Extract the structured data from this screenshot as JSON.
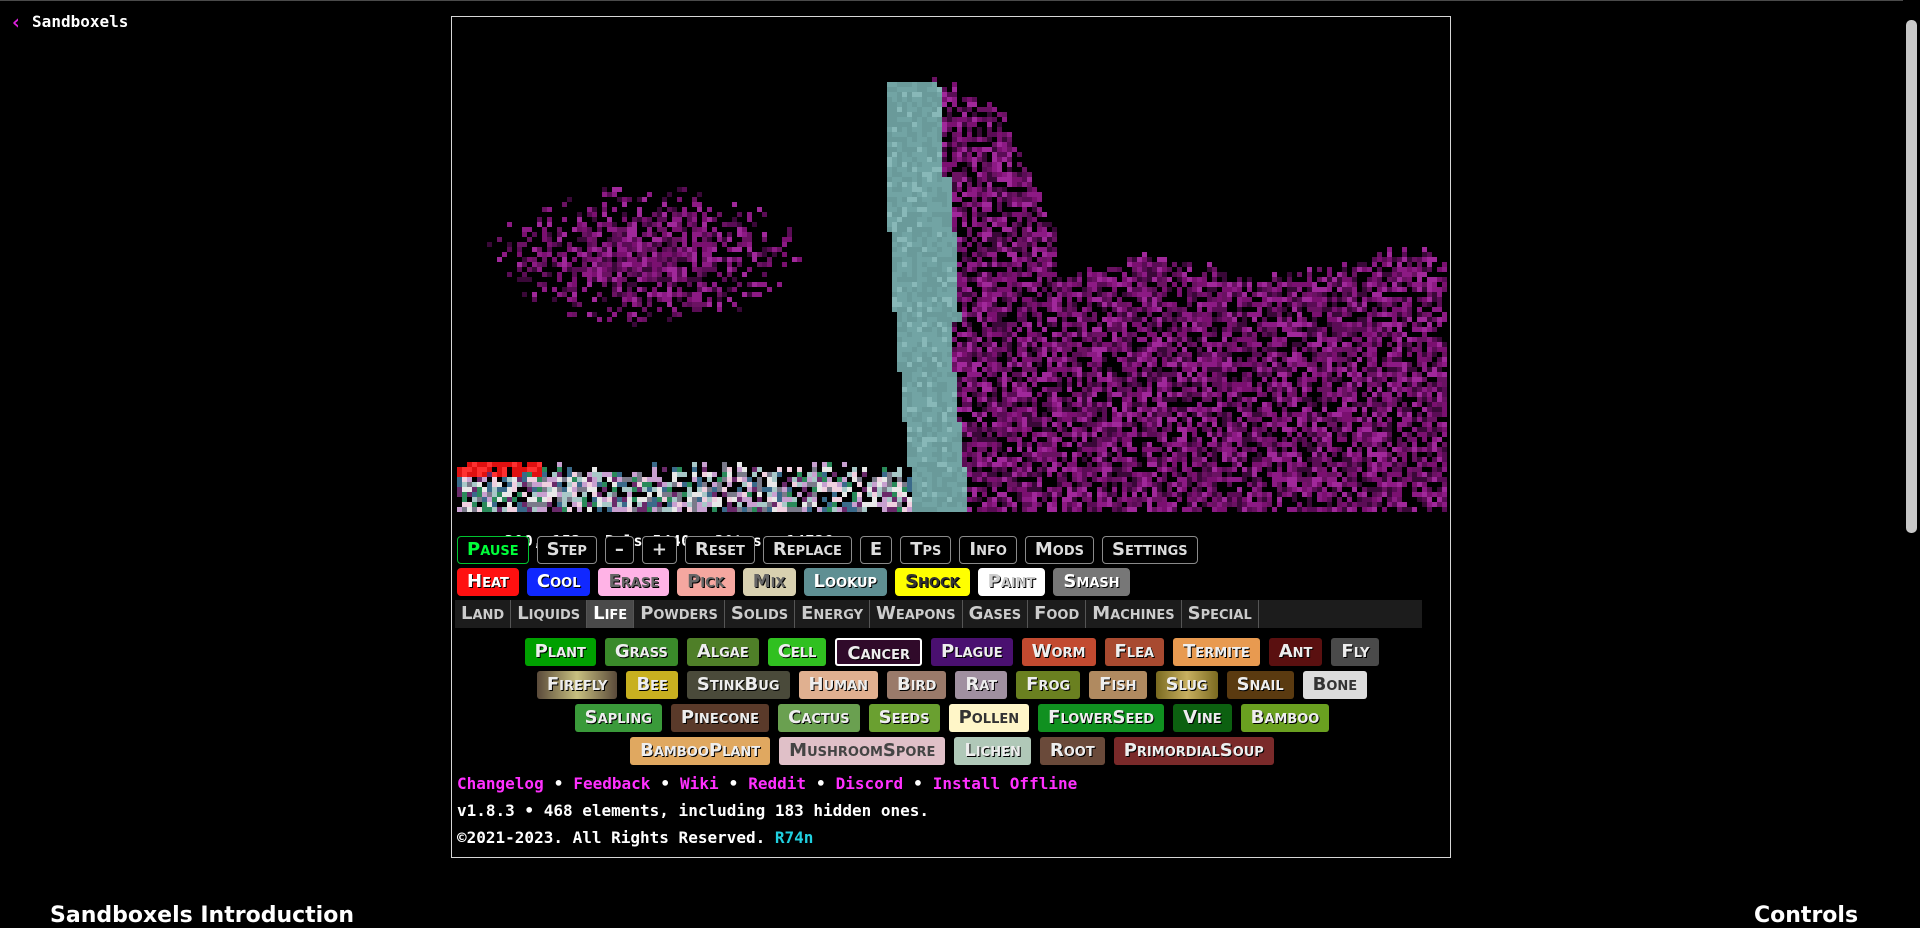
{
  "header": {
    "back_label": "Sandboxels"
  },
  "stats": {
    "coords": "x200,y153",
    "pixels": "Pxls:5440",
    "tps": "30tps",
    "ticks": "14738"
  },
  "controls": [
    {
      "label": "Pause",
      "fg": "#00ff3a",
      "border": "#00c430"
    },
    {
      "label": "Step"
    },
    {
      "label": "–"
    },
    {
      "label": "+"
    },
    {
      "label": "Reset"
    },
    {
      "label": "Replace"
    },
    {
      "label": "E"
    },
    {
      "label": "Tps"
    },
    {
      "label": "Info"
    },
    {
      "label": "Mods"
    },
    {
      "label": "Settings"
    }
  ],
  "tools": [
    {
      "label": "Heat",
      "bg": "#ff1010"
    },
    {
      "label": "Cool",
      "bg": "#1028ff"
    },
    {
      "label": "Erase",
      "bg": "#ffb3e6",
      "fg": "#666"
    },
    {
      "label": "Pick",
      "bg": "#f5a7a0",
      "fg": "#666"
    },
    {
      "label": "Mix",
      "bg": "#d8d0b0",
      "fg": "#666"
    },
    {
      "label": "Lookup",
      "bg": "#5f8f93"
    },
    {
      "label": "Shock",
      "bg": "#ffff00",
      "fg": "#333"
    },
    {
      "label": "Paint",
      "bg": "#ffffff",
      "fg": "#ccc"
    },
    {
      "label": "Smash",
      "bg": "#777777"
    }
  ],
  "categories": [
    "Land",
    "Liquids",
    "Life",
    "Powders",
    "Solids",
    "Energy",
    "Weapons",
    "Gases",
    "Food",
    "Machines",
    "Special"
  ],
  "active_category": "Life",
  "elements": [
    [
      {
        "label": "Plant",
        "bg": "#00a000"
      },
      {
        "label": "Grass",
        "bg": "#3a8a2a"
      },
      {
        "label": "Algae",
        "bg": "#4f7f28"
      },
      {
        "label": "Cell",
        "bg": "#30c020"
      },
      {
        "label": "Cancer",
        "bg": "#300a2a",
        "border": "#ffffff"
      },
      {
        "label": "Plague",
        "bg": "#4a1070"
      },
      {
        "label": "Worm",
        "bg": "#c24a30"
      },
      {
        "label": "Flea",
        "bg": "#a84a30"
      },
      {
        "label": "Termite",
        "bg": "#e89a50"
      },
      {
        "label": "Ant",
        "bg": "#5a1010"
      },
      {
        "label": "Fly",
        "bg": "#4a4a4a"
      }
    ],
    [
      {
        "label": "Firefly",
        "bg": "#5a4a3a",
        "bg2": "#c8c080"
      },
      {
        "label": "Bee",
        "bg": "#c8b020"
      },
      {
        "label": "StinkBug",
        "bg": "#4a4a3a"
      },
      {
        "label": "Human",
        "bg": "#e0b090"
      },
      {
        "label": "Bird",
        "bg": "#9a7a6a"
      },
      {
        "label": "Rat",
        "bg": "#a090a0"
      },
      {
        "label": "Frog",
        "bg": "#6a8020"
      },
      {
        "label": "Fish",
        "bg": "#b08a60"
      },
      {
        "label": "Slug",
        "bg": "#7a6a20",
        "bg2": "#c8b060"
      },
      {
        "label": "Snail",
        "bg": "#5a3a10"
      },
      {
        "label": "Bone",
        "bg": "#dcdcdc",
        "fg": "#333"
      }
    ],
    [
      {
        "label": "Sapling",
        "bg": "#3a9a3a"
      },
      {
        "label": "Pinecone",
        "bg": "#5a3a2a"
      },
      {
        "label": "Cactus",
        "bg": "#6aa050"
      },
      {
        "label": "Seeds",
        "bg": "#6aa030"
      },
      {
        "label": "Pollen",
        "bg": "#fff6c8",
        "fg": "#333"
      },
      {
        "label": "FlowerSeed",
        "bg": "#109020"
      },
      {
        "label": "Vine",
        "bg": "#0c6010"
      },
      {
        "label": "Bamboo",
        "bg": "#6aa020"
      }
    ],
    [
      {
        "label": "BambooPlant",
        "bg": "#e0a860"
      },
      {
        "label": "MushroomSpore",
        "bg": "#e0c0c8",
        "fg": "#444"
      },
      {
        "label": "Lichen",
        "bg": "#b0c8b8"
      },
      {
        "label": "Root",
        "bg": "#6a4a3a"
      },
      {
        "label": "PrimordialSoup",
        "bg": "#7a2a2a"
      }
    ]
  ],
  "links": [
    "Changelog",
    "Feedback",
    "Wiki",
    "Reddit",
    "Discord",
    "Install Offline"
  ],
  "version_text": "v1.8.3 • 468 elements, including 183 hidden ones.",
  "copyright": {
    "text": "©2021-2023. All Rights Reserved. ",
    "author": "R74n"
  },
  "section_headings": {
    "intro": "Sandboxels Introduction",
    "controls": "Controls"
  },
  "colors": {
    "accent": "#e020e0",
    "link": "#ff30ff",
    "author": "#20d0e0"
  }
}
